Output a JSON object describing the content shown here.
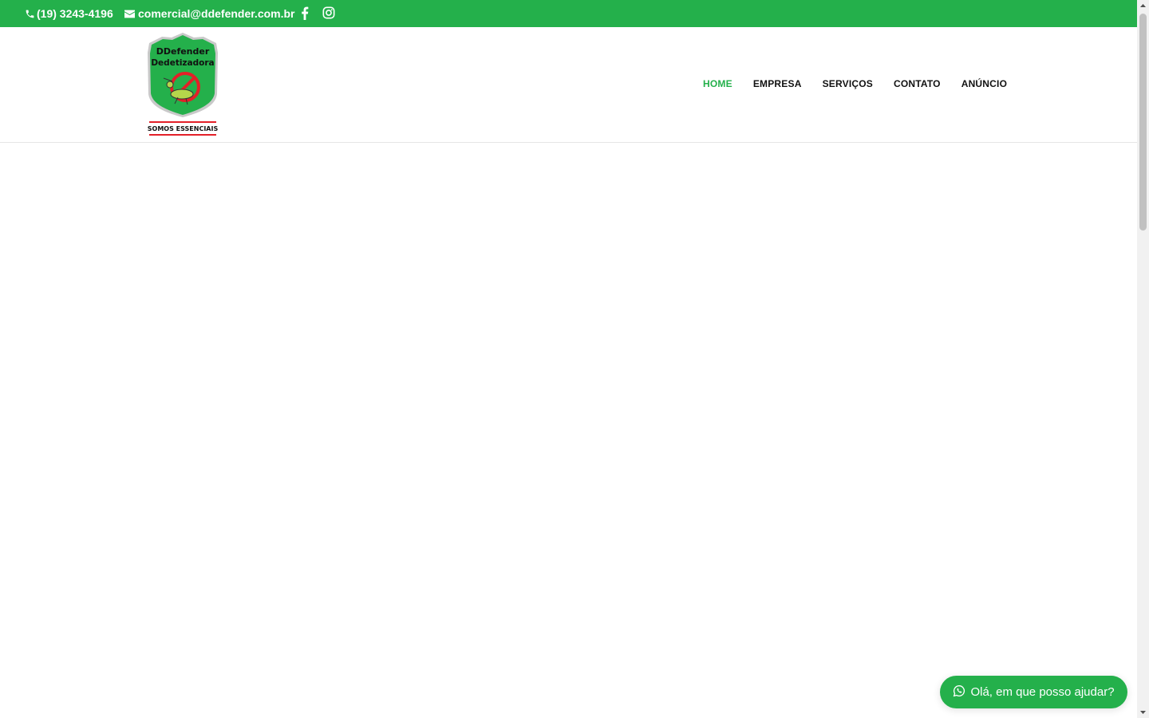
{
  "topbar": {
    "phone": "(19) 3243-4196",
    "email": "comercial@ddefender.com.br",
    "icons": [
      "phone-icon",
      "mail-icon",
      "facebook-icon",
      "instagram-icon"
    ],
    "color": "#24b04b"
  },
  "logo": {
    "line1": "DDefender",
    "line2": "Dedetizadora",
    "tagline": "SOMOS ESSENCIAIS"
  },
  "nav": {
    "items": [
      {
        "label": "HOME",
        "active": true
      },
      {
        "label": "EMPRESA",
        "active": false
      },
      {
        "label": "SERVIÇOS",
        "active": false
      },
      {
        "label": "CONTATO",
        "active": false
      },
      {
        "label": "ANÚNCIO",
        "active": false
      }
    ],
    "active_color": "#24b04b"
  },
  "whatsapp": {
    "label": "Olá, em que posso ajudar?",
    "icon": "whatsapp-icon"
  }
}
